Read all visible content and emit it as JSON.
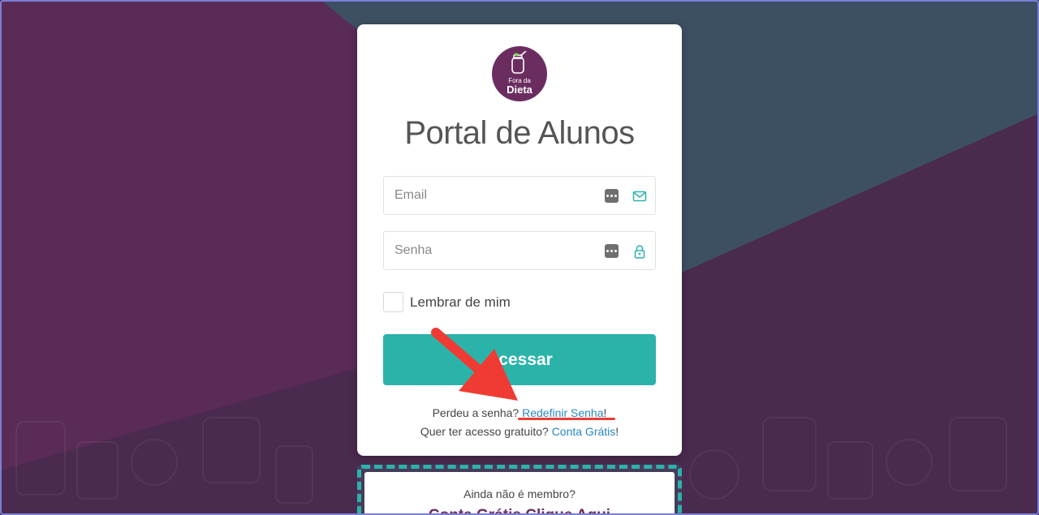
{
  "logo": {
    "line1": "Fora da",
    "line2": "Dieta",
    "color": "#6b2d60"
  },
  "login": {
    "title": "Portal de Alunos",
    "email_placeholder": "Email",
    "password_placeholder": "Senha",
    "remember_label": "Lembrar de mim",
    "submit_label": "Acessar"
  },
  "links": {
    "lost_password_text": "Perdeu a senha?",
    "reset_password_link": "Redefinir Senha",
    "reset_suffix": "!",
    "free_access_text": "Quer ter acesso gratuito?",
    "free_account_link": "Conta Grátis",
    "free_suffix": "!"
  },
  "promo": {
    "question": "Ainda não é membro?",
    "cta": "Conta Grátis Clique Aqui"
  },
  "icons": {
    "email": "mail-icon",
    "password": "lock-icon",
    "password_manager": "password-manager-icon",
    "annotation": "red-arrow-icon"
  },
  "colors": {
    "accent": "#2bb3aa",
    "brand": "#6b2d60",
    "link": "#2a88c8",
    "annotation": "#ef3b33",
    "bg_purple": "#5a2b57",
    "bg_teal": "#3d4f62"
  }
}
